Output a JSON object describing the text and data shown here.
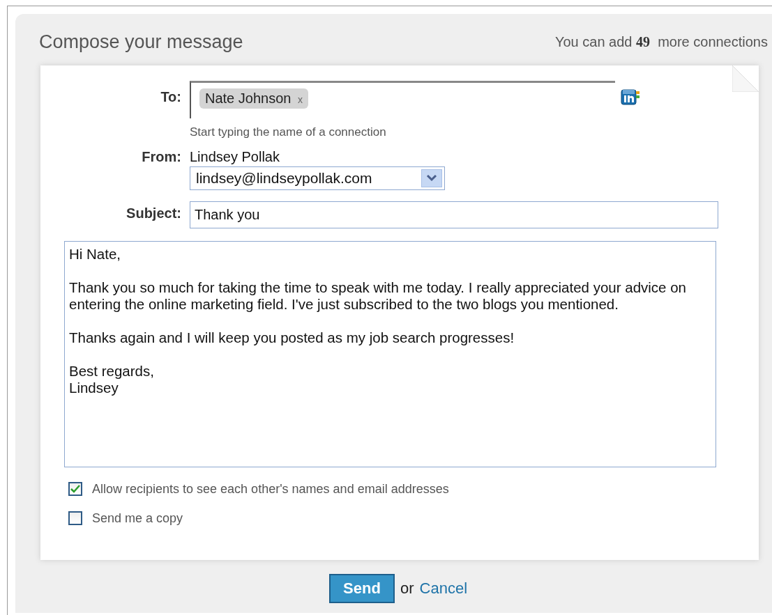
{
  "heading": "Compose your message",
  "connections_note": {
    "before": "You can add",
    "count": "49",
    "after": "more connections"
  },
  "to": {
    "label": "To:",
    "recipients": [
      {
        "name": "Nate Johnson",
        "remove": "x"
      }
    ],
    "hint": "Start typing the name of a connection"
  },
  "from": {
    "label": "From:",
    "name": "Lindsey Pollak",
    "email": "lindsey@lindseypollak.com"
  },
  "subject": {
    "label": "Subject:",
    "value": "Thank you"
  },
  "message": {
    "paragraphs": [
      [
        "Hi Nate,"
      ],
      [
        "Thank you so much for taking the time to speak with me today. I really appreciated your advice on entering the online marketing field. I've just subscribed to the two blogs you mentioned."
      ],
      [
        "Thanks again and I will keep you posted as my job search progresses!"
      ],
      [
        "Best regards,",
        "Lindsey"
      ]
    ]
  },
  "options": [
    {
      "label": "Allow recipients to see each other's names and email addresses",
      "checked": true
    },
    {
      "label": "Send me a copy",
      "checked": false
    }
  ],
  "send_button": "Send",
  "or_text": "or",
  "cancel_link": "Cancel"
}
